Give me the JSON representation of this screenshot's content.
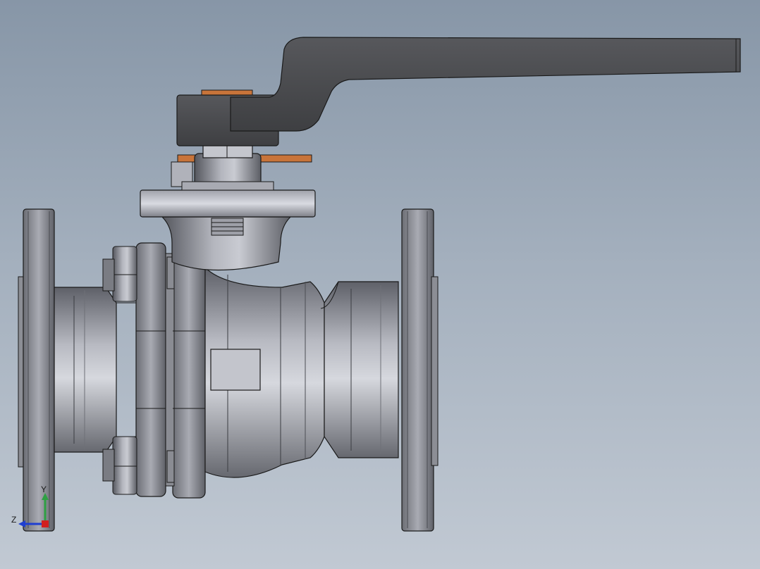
{
  "viewport": {
    "background_top": "#8796a7",
    "background_bottom": "#c1c9d3"
  },
  "model": {
    "name_icon": "ball-valve-3d-model",
    "metal_color": "#9a9ca3",
    "handle_color": "#4a4a4c",
    "washer_color": "#c8743a"
  },
  "triad": {
    "y_label": "Y",
    "z_label": "Z",
    "y_color": "#2ea043",
    "z_color": "#1f3fd1",
    "x_color": "#d11f1f"
  }
}
